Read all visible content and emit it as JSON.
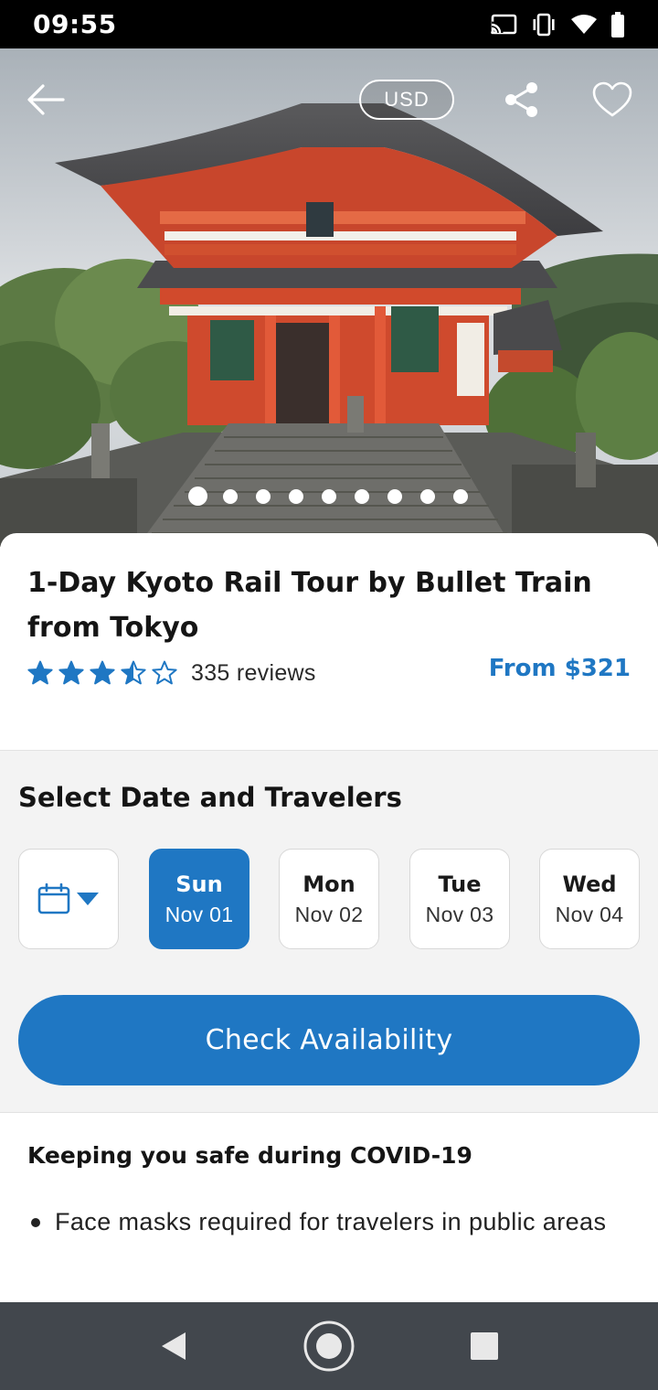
{
  "status_bar": {
    "time": "09:55",
    "icons": [
      "cast-icon",
      "vibrate-icon",
      "wifi-icon",
      "battery-icon"
    ]
  },
  "hero": {
    "currency_label": "USD",
    "icons": [
      "back-arrow-icon",
      "share-icon",
      "heart-icon"
    ],
    "carousel_total": 9,
    "carousel_active": 0
  },
  "product": {
    "title": "1-Day Kyoto Rail Tour by Bullet Train from Tokyo",
    "rating": 3.5,
    "rating_max": 5,
    "reviews": "335 reviews",
    "price": "From $321"
  },
  "booking": {
    "title": "Select Date and Travelers",
    "calendar_icon": "calendar-icon",
    "dates": [
      {
        "day": "Sun",
        "date": "Nov 01",
        "selected": true
      },
      {
        "day": "Mon",
        "date": "Nov 02",
        "selected": false
      },
      {
        "day": "Tue",
        "date": "Nov 03",
        "selected": false
      },
      {
        "day": "Wed",
        "date": "Nov 04",
        "selected": false
      }
    ],
    "cta": "Check Availability"
  },
  "covid": {
    "title": "Keeping you safe during COVID-19",
    "items": [
      "Face masks required for travelers in public areas"
    ]
  },
  "colors": {
    "accent": "#1f77c3",
    "nav_bar": "#42474d",
    "panel_bg": "#f3f3f3"
  },
  "nav_bar": {
    "icons": [
      "nav-back-icon",
      "nav-home-icon",
      "nav-recents-icon"
    ]
  }
}
